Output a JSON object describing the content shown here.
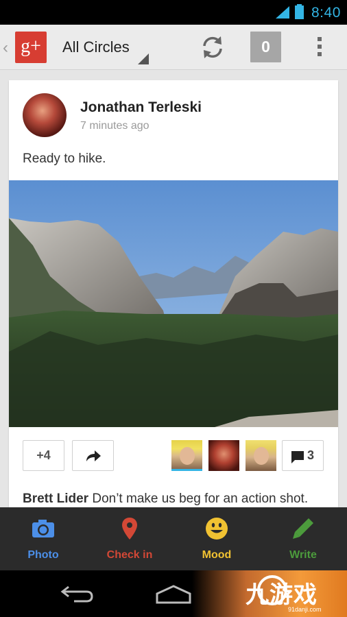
{
  "status_bar": {
    "time": "8:40"
  },
  "action_bar": {
    "logo_text": "g+",
    "circle_title": "All Circles",
    "notification_count": "0"
  },
  "post": {
    "author": "Jonathan Terleski",
    "time": "7 minutes ago",
    "text": "Ready to hike.",
    "plus_label": "+4",
    "comment_count": "3",
    "comment_author": "Brett Lider",
    "comment_text": "Don’t make us beg for an action shot."
  },
  "bottom_bar": {
    "items": [
      {
        "label": "Photo",
        "color": "#4c8fe8"
      },
      {
        "label": "Check in",
        "color": "#d34836"
      },
      {
        "label": "Mood",
        "color": "#f1c232"
      },
      {
        "label": "Write",
        "color": "#4c9b3c"
      }
    ]
  },
  "watermark": {
    "text": "九游戏",
    "sub": "91danji.com"
  },
  "colors": {
    "accent": "#33b5e5",
    "gplus_red": "#d73d32"
  }
}
